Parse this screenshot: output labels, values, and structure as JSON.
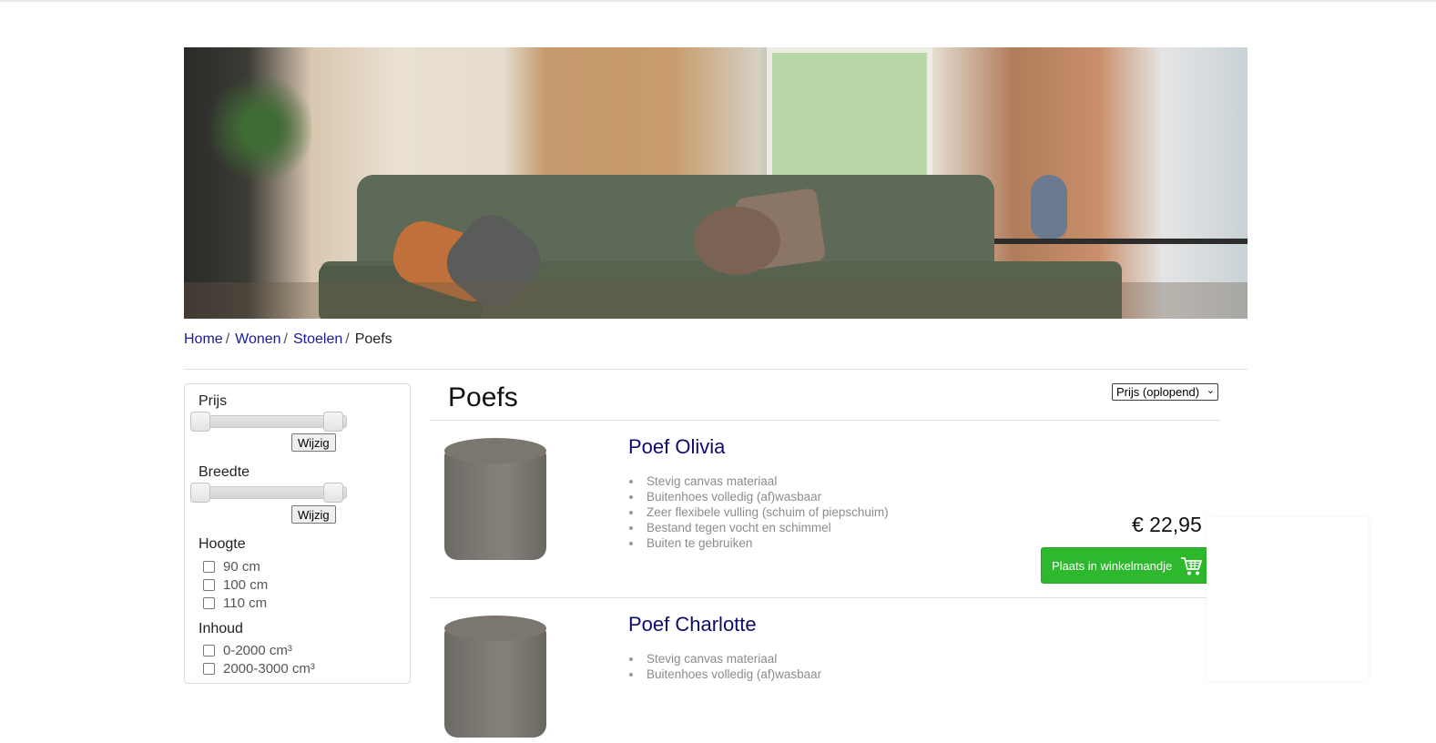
{
  "hero": {
    "alt": "Woonkamer met groene hoekbank"
  },
  "breadcrumb": {
    "items": [
      "Home",
      "Wonen",
      "Stoelen"
    ],
    "current": "Poefs",
    "separator": "/"
  },
  "filters": {
    "price": {
      "title": "Prijs",
      "button": "Wijzig"
    },
    "width": {
      "title": "Breedte",
      "button": "Wijzig"
    },
    "height": {
      "title": "Hoogte",
      "options": [
        "90 cm",
        "100 cm",
        "110 cm"
      ]
    },
    "content": {
      "title": "Inhoud",
      "options": [
        "0-2000 cm³",
        "2000-3000 cm³"
      ]
    }
  },
  "main": {
    "title": "Poefs",
    "sort": {
      "selected": "Prijs (oplopend)"
    }
  },
  "products": [
    {
      "name": "Poef Olivia",
      "features": [
        "Stevig canvas materiaal",
        "Buitenhoes volledig (af)wasbaar",
        "Zeer flexibele vulling (schuim of piepschuim)",
        "Bestand tegen vocht en schimmel",
        "Buiten te gebruiken"
      ],
      "price": "€ 22,95",
      "cart_button": "Plaats in winkelmandje"
    },
    {
      "name": "Poef Charlotte",
      "features": [
        "Stevig canvas materiaal",
        "Buitenhoes volledig (af)wasbaar"
      ]
    }
  ],
  "colors": {
    "link": "#1a1a9c",
    "product_title": "#0b0b6e",
    "cart_button": "#2eb82e"
  },
  "icons": {
    "cart": "shopping-cart-icon",
    "dropdown": "chevron-down-icon"
  }
}
